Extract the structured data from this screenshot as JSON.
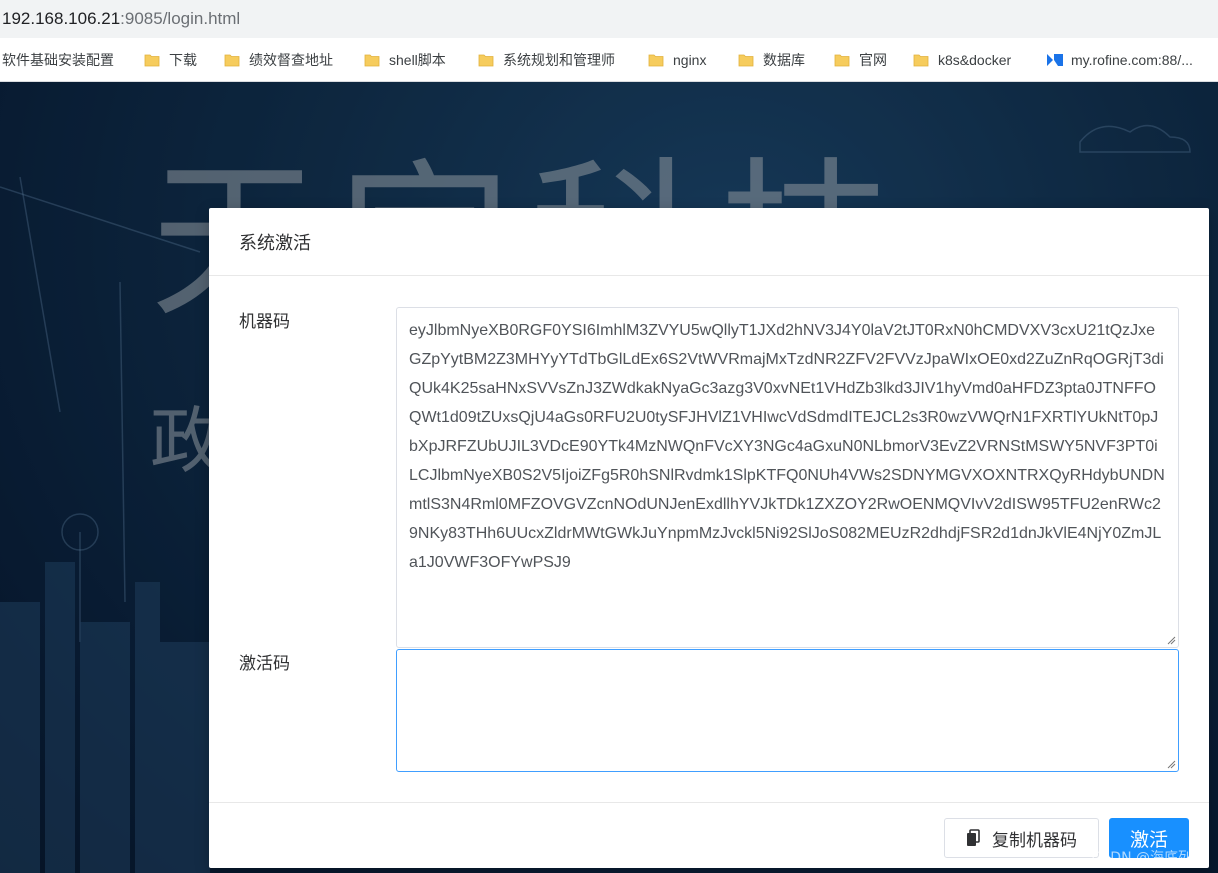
{
  "browser": {
    "url_host": "192.168.106.21",
    "url_rest": ":9085/login.html"
  },
  "bookmarks": [
    {
      "label": "软件基础安装配置",
      "icon": "none"
    },
    {
      "label": "下载",
      "icon": "folder-icon"
    },
    {
      "label": "绩效督查地址",
      "icon": "folder-icon"
    },
    {
      "label": "shell脚本",
      "icon": "folder-icon"
    },
    {
      "label": "系统规划和管理师",
      "icon": "folder-icon"
    },
    {
      "label": "nginx",
      "icon": "folder-icon"
    },
    {
      "label": "数据库",
      "icon": "folder-icon"
    },
    {
      "label": "官网",
      "icon": "folder-icon"
    },
    {
      "label": "k8s&docker",
      "icon": "folder-icon"
    },
    {
      "label": "my.rofine.com:88/...",
      "icon": "site-icon"
    }
  ],
  "background": {
    "title": "天宇科技",
    "subtitle": "政"
  },
  "modal": {
    "title": "系统激活",
    "machine_code_label": "机器码",
    "machine_code_value": "eyJlbmNyeXB0RGF0YSI6ImhlM3ZVYU5wQllyT1JXd2hNV3J4Y0laV2tJT0RxN0hCMDVXV3cxU21tQzJxeGZpYytBM2Z3MHYyYTdTbGlLdEx6S2VtWVRmajMxTzdNR2ZFV2FVVzJpaWIxOE0xd2ZuZnRqOGRjT3diQUk4K25saHNxSVVsZnJ3ZWdkakNyaGc3azg3V0xvNEt1VHdZb3lkd3JIV1hyVmd0aHFDZ3pta0JTNFFOQWt1d09tZUxsQjU4aGs0RFU2U0tySFJHVlZ1VHIwcVdSdmdITEJCL2s3R0wzVWQrN1FXRTlYUkNtT0pJbXpJRFZUbUJIL3VDcE90YTk4MzNWQnFVcXY3NGc4aGxuN0NLbmorV3EvZ2VRNStMSWY5NVF3PT0iLCJlbmNyeXB0S2V5IjoiZFg5R0hSNlRvdmk1SlpKTFQ0NUh4VWs2SDNYMGVXOXNTRXQyRHdybUNDNmtlS3N4Rml0MFZOVGVZcnNOdUNJenExdllhYVJkTDk1ZXZOY2RwOENMQVIvV2dISW95TFU2enRWc29NKy83THh6UUcxZldrMWtGWkJuYnpmMzJvckl5Ni92SlJoS082MEUzR2dhdjFSR2d1dnJkVlE4NjY0ZmJLa1J0VWF3OFYwPSJ9",
    "activation_code_label": "激活码",
    "activation_code_value": "",
    "copy_button_label": "复制机器码",
    "activate_button_label": "激活"
  },
  "watermark": "CSDN @海底列车"
}
